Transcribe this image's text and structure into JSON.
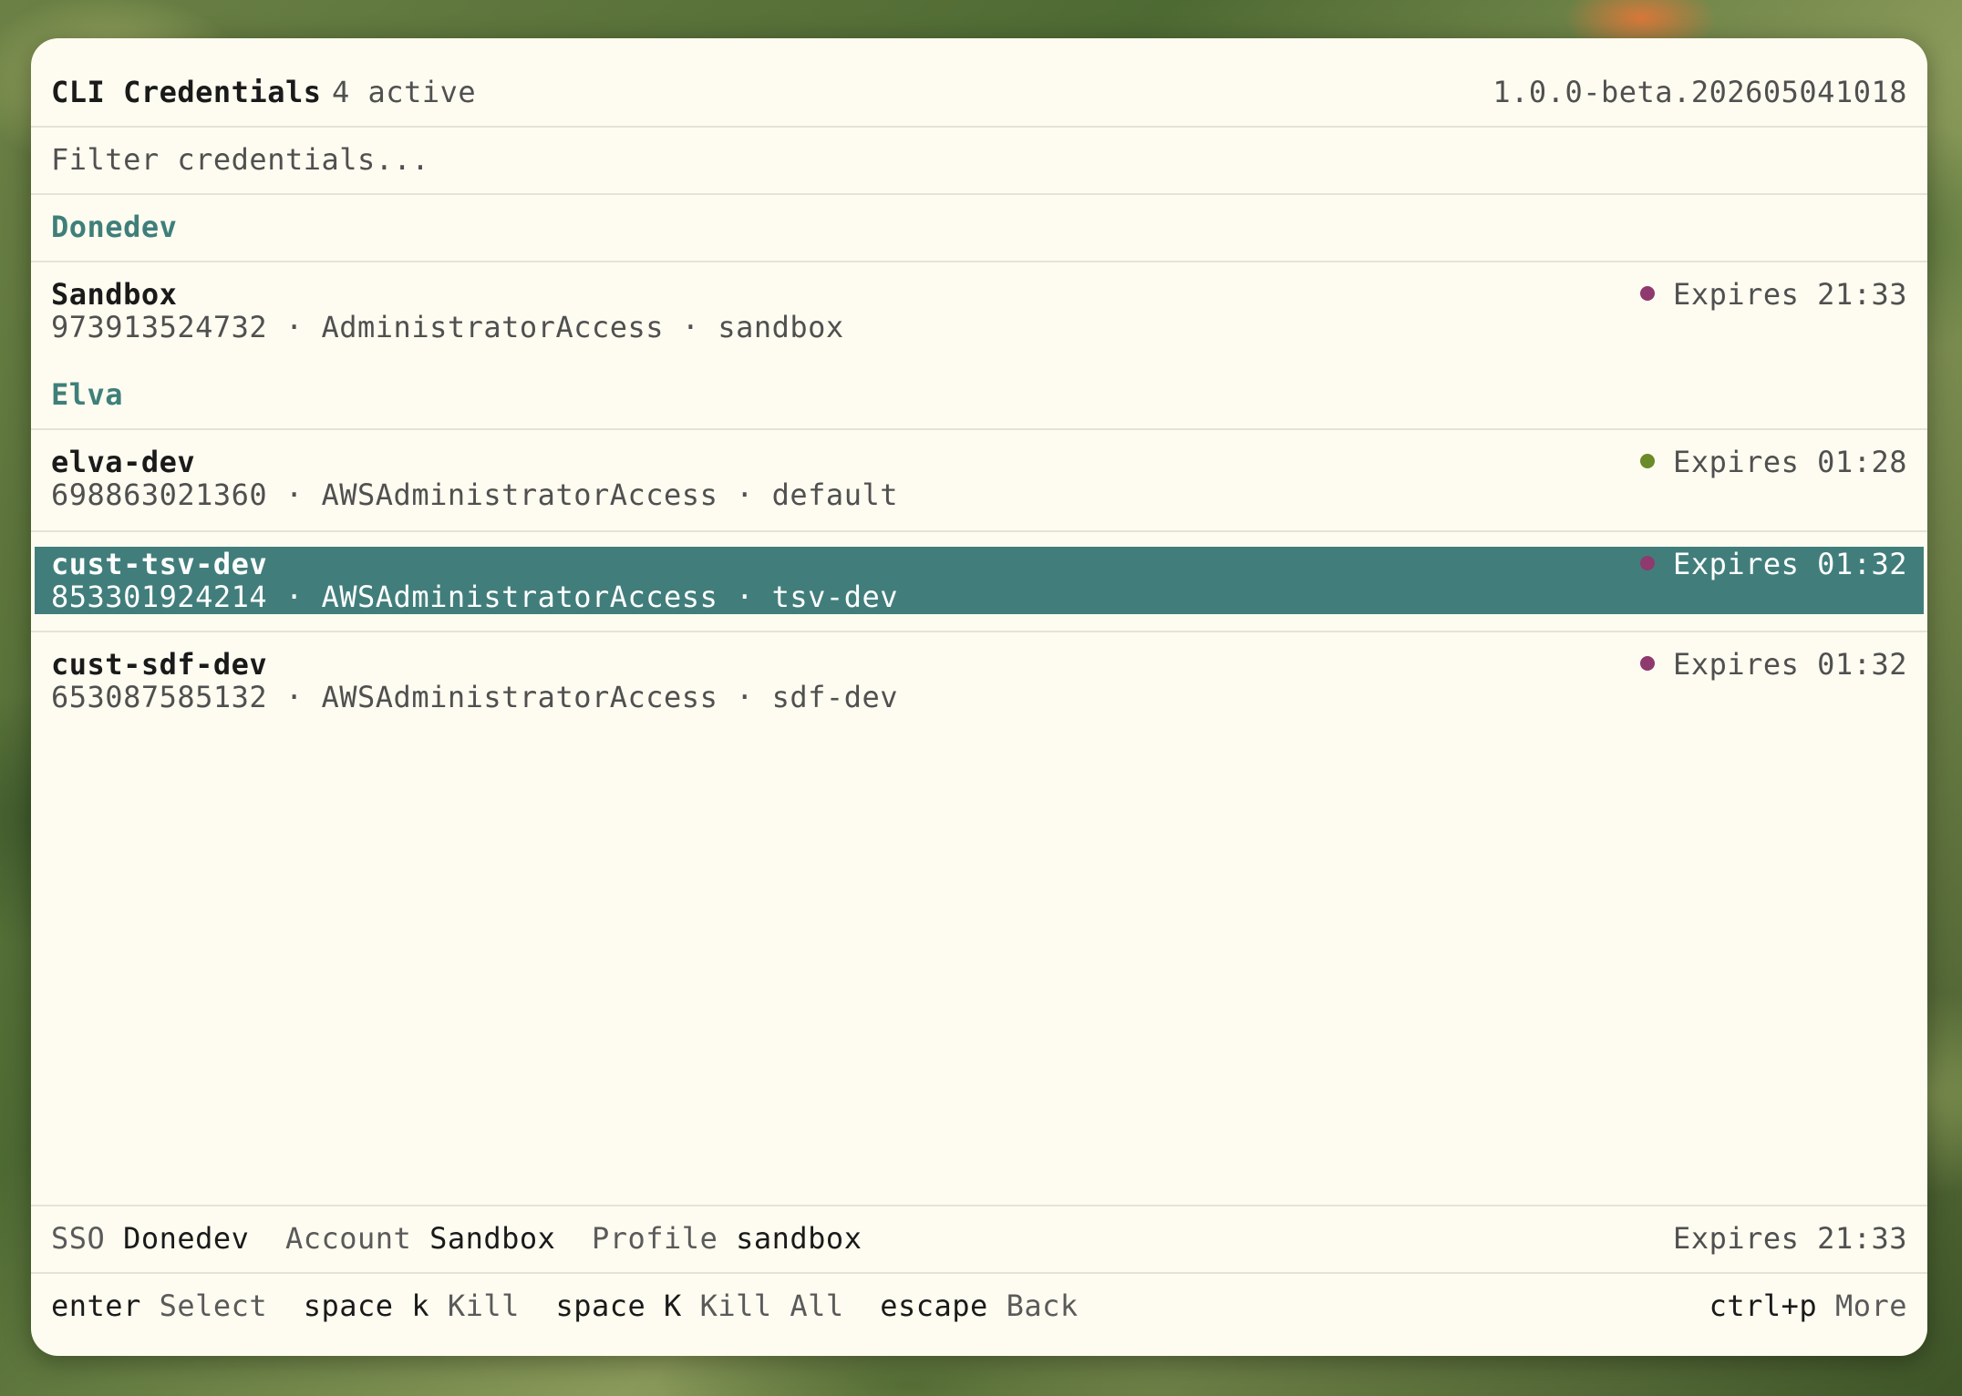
{
  "header": {
    "title": "CLI Credentials",
    "active_count": "4 active",
    "version": "1.0.0-beta.202605041018"
  },
  "filter": {
    "placeholder": "Filter credentials..."
  },
  "groups": [
    {
      "name": "Donedev",
      "items": [
        {
          "name": "Sandbox",
          "account": "973913524732",
          "role": "AdministratorAccess",
          "profile": "sandbox",
          "expires": "Expires 21:33",
          "status_color": "#8e3a6e"
        }
      ]
    },
    {
      "name": "Elva",
      "items": [
        {
          "name": "elva-dev",
          "account": "698863021360",
          "role": "AWSAdministratorAccess",
          "profile": "default",
          "expires": "Expires 01:28",
          "status_color": "#6b8a2a"
        },
        {
          "name": "cust-tsv-dev",
          "account": "853301924214",
          "role": "AWSAdministratorAccess",
          "profile": "tsv-dev",
          "expires": "Expires 01:32",
          "status_color": "#8e3a6e",
          "selected": true
        },
        {
          "name": "cust-sdf-dev",
          "account": "653087585132",
          "role": "AWSAdministratorAccess",
          "profile": "sdf-dev",
          "expires": "Expires 01:32",
          "status_color": "#8e3a6e"
        }
      ]
    }
  ],
  "separator": "·",
  "status_bar": {
    "sso_label": "SSO",
    "sso_value": "Donedev",
    "account_label": "Account",
    "account_value": "Sandbox",
    "profile_label": "Profile",
    "profile_value": "sandbox",
    "expires": "Expires 21:33"
  },
  "keybar": [
    {
      "key": "enter",
      "action": "Select"
    },
    {
      "key": "space k",
      "action": "Kill"
    },
    {
      "key": "space K",
      "action": "Kill All"
    },
    {
      "key": "escape",
      "action": "Back"
    }
  ],
  "keybar_right": {
    "key": "ctrl+p",
    "action": "More"
  }
}
